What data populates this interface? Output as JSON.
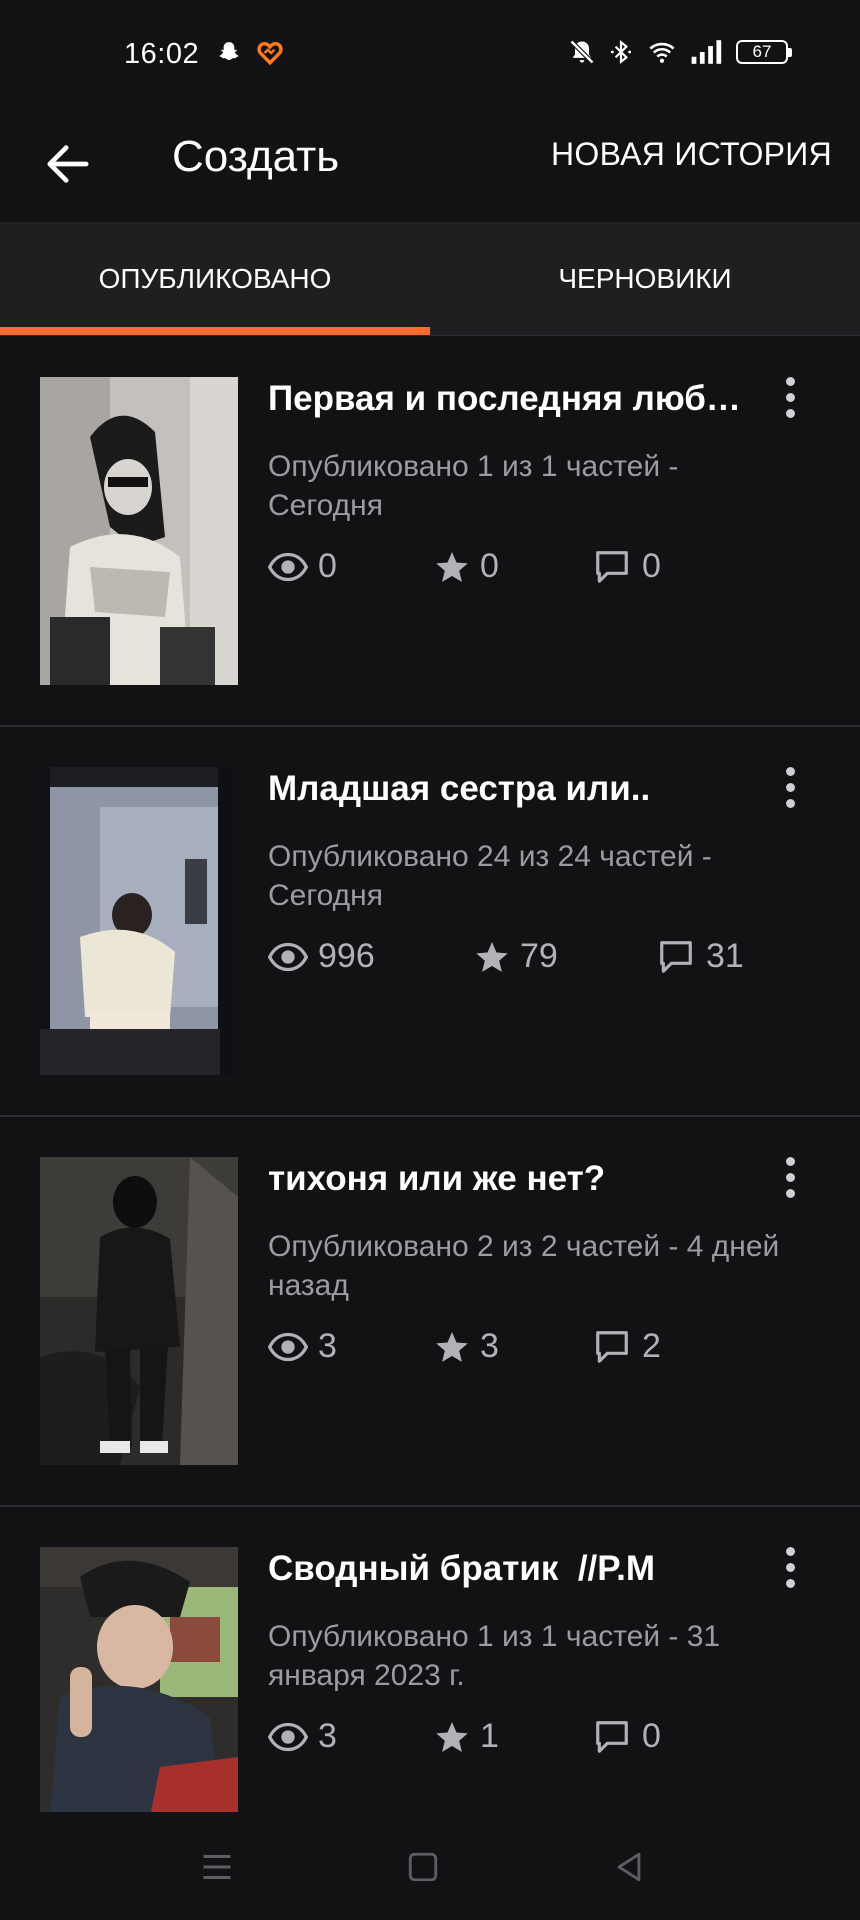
{
  "status_bar": {
    "time": "16:02",
    "battery": "67",
    "icons": [
      "snapchat-icon",
      "app-heart-icon",
      "bell-off-icon",
      "bluetooth-icon",
      "wifi-icon",
      "signal-icon"
    ]
  },
  "header": {
    "title": "Создать",
    "new_story_label": "НОВАЯ ИСТОРИЯ"
  },
  "tabs": [
    {
      "label": "ОПУБЛИКОВАНО",
      "active": true
    },
    {
      "label": "ЧЕРНОВИКИ",
      "active": false
    }
  ],
  "colors": {
    "accent": "#ff6c2f",
    "background": "#121113",
    "tab_bar": "#1f1e21",
    "meta_text": "#9d9ba0"
  },
  "stories": [
    {
      "title": "Первая и последняя люб…",
      "meta": "Опубликовано 1 из 1 частей - Сегодня",
      "views": "0",
      "votes": "0",
      "comments": "0"
    },
    {
      "title": "Младшая сестра или..",
      "meta": "Опубликовано 24 из 24 частей - Сегодня",
      "views": "996",
      "votes": "79",
      "comments": "31"
    },
    {
      "title": "тихоня или же нет?",
      "meta": "Опубликовано 2 из 2 частей - 4 дней назад",
      "views": "3",
      "votes": "3",
      "comments": "2"
    },
    {
      "title": "Сводный братик  //P.M",
      "meta": "Опубликовано 1 из 1 частей - 31 января 2023 г.",
      "views": "3",
      "votes": "1",
      "comments": "0"
    }
  ]
}
